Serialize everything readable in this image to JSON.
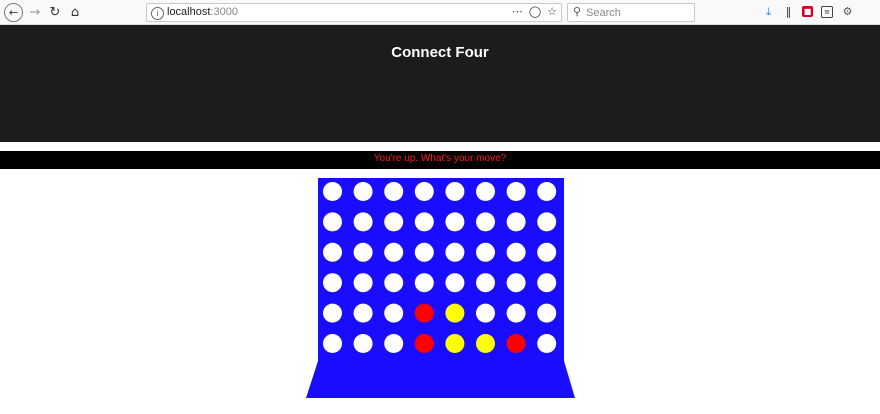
{
  "browser": {
    "url_host": "localhost",
    "url_port": ":3000",
    "search_placeholder": "Search",
    "icons": [
      "back-icon",
      "forward-icon",
      "reload-icon",
      "home-icon",
      "page-info-icon",
      "more-actions-icon",
      "pocket-icon",
      "bookmark-star-icon",
      "search-icon",
      "download-icon",
      "library-icon",
      "extension-icon",
      "reader-icon",
      "settings-icon"
    ]
  },
  "page": {
    "title": "Connect Four",
    "status": "You're up. What's your move?"
  },
  "board": {
    "columns": 8,
    "rows": 6,
    "colors": {
      "frame": "#1a0dff",
      "empty": "#ffffff",
      "red": "#ff0000",
      "yellow": "#ffff00"
    },
    "cells": [
      [
        "empty",
        "empty",
        "empty",
        "empty",
        "empty",
        "empty",
        "empty",
        "empty"
      ],
      [
        "empty",
        "empty",
        "empty",
        "empty",
        "empty",
        "empty",
        "empty",
        "empty"
      ],
      [
        "empty",
        "empty",
        "empty",
        "empty",
        "empty",
        "empty",
        "empty",
        "empty"
      ],
      [
        "empty",
        "empty",
        "empty",
        "empty",
        "empty",
        "empty",
        "empty",
        "empty"
      ],
      [
        "empty",
        "empty",
        "empty",
        "red",
        "yellow",
        "empty",
        "empty",
        "empty"
      ],
      [
        "empty",
        "empty",
        "empty",
        "red",
        "yellow",
        "yellow",
        "red",
        "empty"
      ]
    ]
  }
}
